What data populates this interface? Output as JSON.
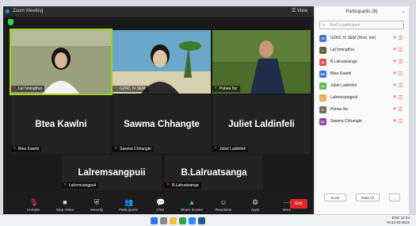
{
  "window": {
    "title": "Zoom Meeting",
    "view_label": "View"
  },
  "tiles": [
    {
      "id": "lal",
      "label": "Lal hmingthui",
      "type": "video"
    },
    {
      "id": "gzrc",
      "label": "GZRC IV SEM",
      "type": "video"
    },
    {
      "id": "puhea",
      "label": "Puhea Ibc",
      "type": "video"
    },
    {
      "id": "btea",
      "label": "Btea Kawlni",
      "big": "Btea Kawlni",
      "type": "name"
    },
    {
      "id": "sawma",
      "label": "Sawma Chhangte",
      "big": "Sawma Chhangte",
      "type": "name"
    },
    {
      "id": "juliet",
      "label": "Juliet Laldinfeli",
      "big": "Juliet Laldinfeli",
      "type": "name"
    },
    {
      "id": "lalrem",
      "label": "Lalremsangpuii",
      "big": "Lalremsangpuii",
      "type": "name"
    },
    {
      "id": "blal",
      "label": "B.Lalruatsanga",
      "big": "B.Lalruatsanga",
      "type": "name"
    }
  ],
  "toolbar": {
    "unmute": "Unmute",
    "stop_video": "Stop Video",
    "security": "Security",
    "participants": "Participants",
    "participants_count": "8",
    "chat": "Chat",
    "share": "Share Screen",
    "reactions": "Reactions",
    "apps": "Apps",
    "more": "More",
    "end": "End"
  },
  "panel": {
    "title": "Participants (8)",
    "search_placeholder": "Find a participant",
    "people": [
      {
        "name": "GZRC IV SEM (Host, me)",
        "initials": "G",
        "color": "#4a79c4"
      },
      {
        "name": "Lal hmingthui",
        "initials": "L",
        "color": "#6b5b4b"
      },
      {
        "name": "B.Lalruatsanga",
        "initials": "B",
        "color": "#d9534f"
      },
      {
        "name": "Btea Kawlni",
        "initials": "BK",
        "color": "#2d7be0"
      },
      {
        "name": "Juliet Laldinfeli",
        "initials": "JL",
        "color": "#5cb85c"
      },
      {
        "name": "Lalremsangpuii",
        "initials": "L",
        "color": "#f0ad4e"
      },
      {
        "name": "Puhea Ibc",
        "initials": "P",
        "color": "#7a6a5a"
      },
      {
        "name": "Sawma Chhangte",
        "initials": "SC",
        "color": "#8e44ad"
      }
    ],
    "invite": "Invite",
    "mute_all": "Mute All",
    "more": "..."
  },
  "taskbar": {
    "lang": "ENG",
    "region": "IN",
    "time": "12:44",
    "date": "24-03-2022"
  }
}
